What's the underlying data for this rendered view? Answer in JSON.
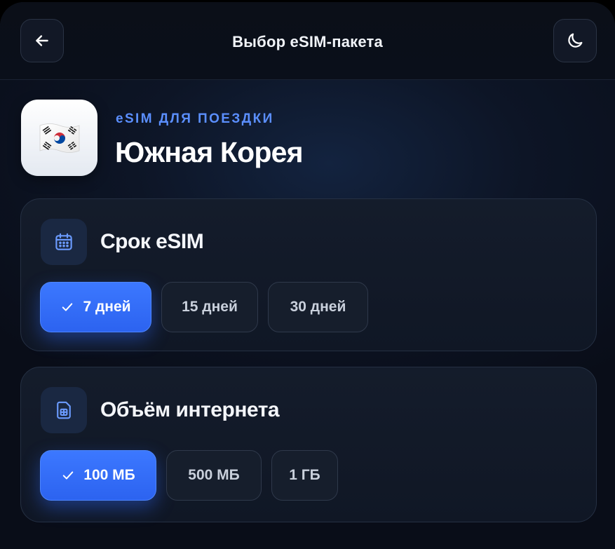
{
  "header": {
    "title": "Выбор eSIM-пакета",
    "back_icon": "arrow-left-icon",
    "theme_icon": "moon-icon"
  },
  "hero": {
    "flag": "🇰🇷",
    "flag_icon": "south-korea-flag-icon",
    "eyebrow": "eSIM ДЛЯ ПОЕЗДКИ",
    "country": "Южная Корея"
  },
  "duration": {
    "icon": "calendar-icon",
    "title": "Срок eSIM",
    "options": [
      {
        "label": "7 дней",
        "selected": true
      },
      {
        "label": "15 дней",
        "selected": false
      },
      {
        "label": "30 дней",
        "selected": false
      }
    ]
  },
  "data_volume": {
    "icon": "sim-card-icon",
    "title": "Объём интернета",
    "options": [
      {
        "label": "100 МБ",
        "selected": true
      },
      {
        "label": "500 МБ",
        "selected": false
      },
      {
        "label": "1 ГБ",
        "selected": false
      }
    ]
  },
  "colors": {
    "accent": "#3c78ff",
    "eyebrow": "#5b8fff",
    "background": "#0b1120",
    "card": "#141c2b"
  }
}
